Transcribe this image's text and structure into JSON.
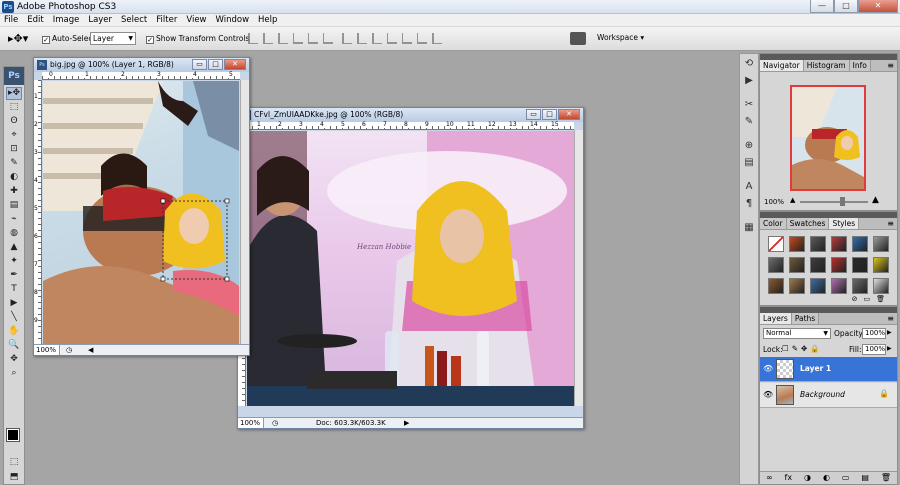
{
  "app": {
    "title": "Adobe Photoshop CS3",
    "icon": "Ps"
  },
  "window_controls": {
    "minimize": "—",
    "maximize": "□",
    "close": "✕"
  },
  "menu": [
    "File",
    "Edit",
    "Image",
    "Layer",
    "Select",
    "Filter",
    "View",
    "Window",
    "Help"
  ],
  "options": {
    "auto_select_label": "Auto-Select:",
    "auto_select_value": "Layer",
    "show_transform_label": "Show Transform Controls",
    "workspace_label": "Workspace ▾"
  },
  "toolbox": {
    "logo": "Ps",
    "tools": [
      "▸✥",
      "⬚",
      "ʘ",
      "⌖",
      "⊡",
      "✎",
      "◐",
      "✚",
      "▤",
      "⌁",
      "◍",
      "▲",
      "✦",
      "✒",
      "T",
      "▶",
      "╲",
      "✋",
      "🔍",
      "✥",
      "⌕",
      "⬚",
      "⬒"
    ]
  },
  "doc1": {
    "title": "big.jpg @ 100% (Layer 1, RGB/8)",
    "zoom": "100%",
    "ruler_h": [
      "0",
      "1",
      "2",
      "3",
      "4",
      "5"
    ],
    "ruler_v": [
      "1",
      "2",
      "3",
      "4",
      "5",
      "6",
      "7",
      "8",
      "9"
    ]
  },
  "doc2": {
    "title": "CFvl_ZmUIAADKke.jpg @ 100% (RGB/8)",
    "zoom": "100%",
    "status": "Doc: 603.3K/603.3K",
    "ruler_h": [
      "1",
      "2",
      "3",
      "4",
      "5",
      "6",
      "7",
      "8",
      "9",
      "10",
      "11",
      "12",
      "13",
      "14",
      "15",
      "16"
    ],
    "watermark": "Hezzan Hobbie"
  },
  "navigator": {
    "tabs": [
      "Navigator",
      "Histogram",
      "Info"
    ],
    "zoom": "100%"
  },
  "styles": {
    "tabs": [
      "Color",
      "Swatches",
      "Styles"
    ],
    "swatches": [
      "#ffffff",
      "#c64a1a",
      "#5a5a5a",
      "#b23a3a",
      "#2b6fb6",
      "#9a9a9a",
      "#6e6e6e",
      "#6d5a3a",
      "#3e3e3e",
      "#b43030",
      "#2a2a2a",
      "#d9c21a",
      "#8e5a2a",
      "#a0784a",
      "#3b6ea8",
      "#b06fb0",
      "#6a6a6a",
      "#e0e0e0"
    ]
  },
  "layers": {
    "tabs": [
      "Layers",
      "Paths"
    ],
    "blend_mode": "Normal",
    "opacity_label": "Opacity:",
    "opacity": "100%",
    "lock_label": "Lock:",
    "fill_label": "Fill:",
    "fill": "100%",
    "items": [
      {
        "name": "Layer 1",
        "selected": true
      },
      {
        "name": "Background",
        "selected": false
      }
    ],
    "footer_icons": [
      "∞",
      "fx",
      "◑",
      "◐",
      "▭",
      "▤",
      "🗑"
    ]
  }
}
